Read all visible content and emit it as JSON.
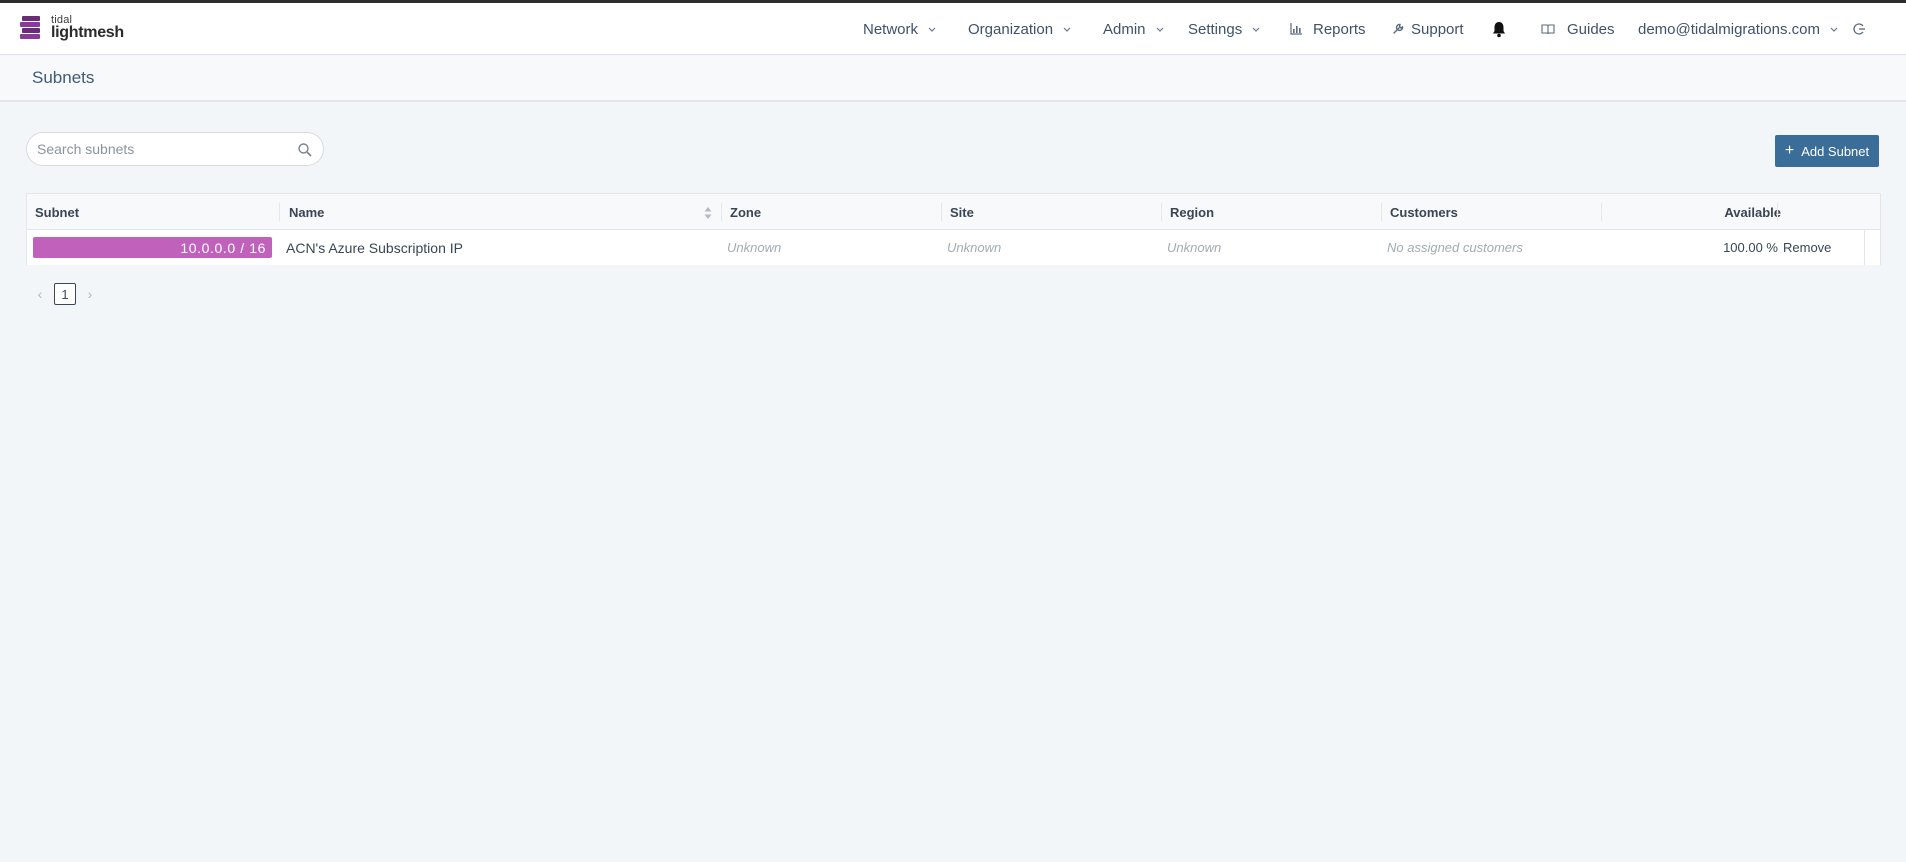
{
  "brand": {
    "small": "tidal",
    "big": "lightmesh"
  },
  "nav": {
    "network": "Network",
    "organization": "Organization",
    "admin": "Admin",
    "settings": "Settings",
    "reports": "Reports",
    "support": "Support",
    "guides": "Guides",
    "user": "demo@tidalmigrations.com"
  },
  "page": {
    "title": "Subnets"
  },
  "search": {
    "placeholder": "Search subnets"
  },
  "actions": {
    "add_subnet": "Add Subnet"
  },
  "table": {
    "columns": {
      "subnet": "Subnet",
      "name": "Name",
      "zone": "Zone",
      "site": "Site",
      "region": "Region",
      "customers": "Customers",
      "available": "Available"
    },
    "rows": [
      {
        "subnet": "10.0.0.0 / 16",
        "subnet_bar_color": "#c062bc",
        "name": "ACN's Azure Subscription IP",
        "zone": "Unknown",
        "site": "Unknown",
        "region": "Unknown",
        "customers": "No assigned customers",
        "available": "100.00 %",
        "action": "Remove"
      }
    ]
  },
  "pagination": {
    "current": "1",
    "prev": "‹",
    "next": "›"
  },
  "colors": {
    "primary": "#3a6d97",
    "subnet_bar": "#c062bc",
    "background": "#f3f6f9"
  },
  "icons": [
    "chevron-down-icon",
    "bar-chart-icon",
    "wrench-icon",
    "bell-icon",
    "book-icon",
    "logout-icon",
    "search-icon",
    "plus-icon",
    "sort-icon"
  ]
}
